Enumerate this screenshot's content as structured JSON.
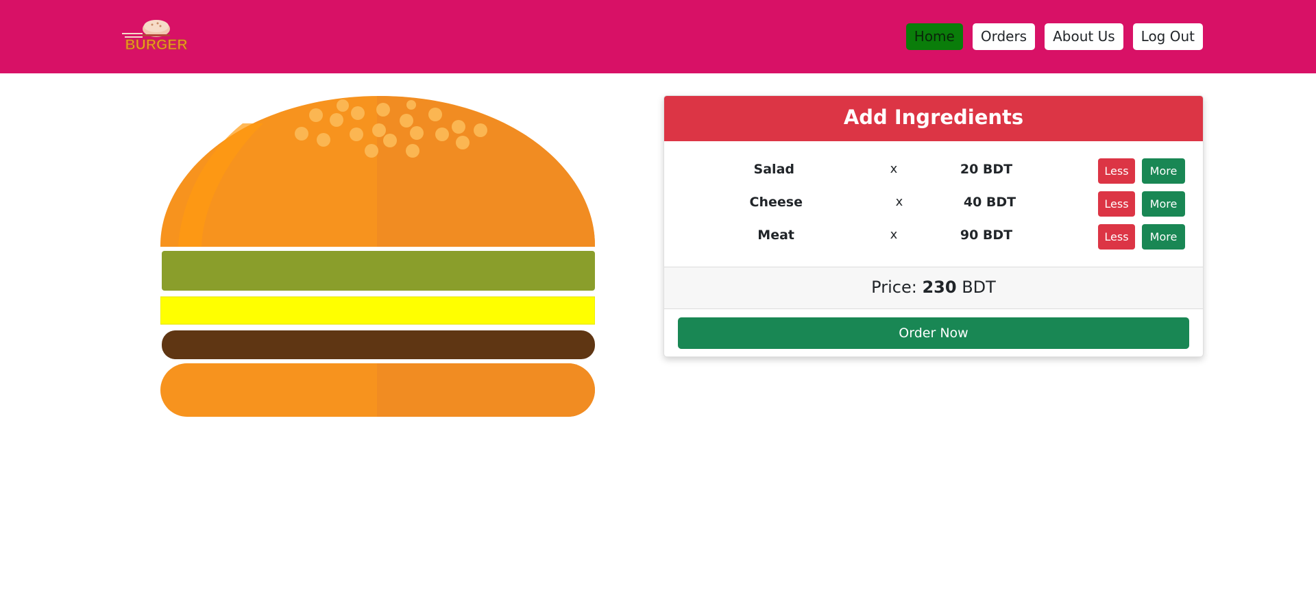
{
  "nav": {
    "logo_text": "BURGER",
    "links": [
      {
        "label": "Home",
        "active": true
      },
      {
        "label": "Orders",
        "active": false
      },
      {
        "label": "About Us",
        "active": false
      },
      {
        "label": "Log Out",
        "active": false
      }
    ]
  },
  "burger": {
    "layers": [
      "salad",
      "cheese",
      "meat"
    ],
    "colors": {
      "bun": "#f7931e",
      "salad": "#8a9e2b",
      "cheese": "#ffff00",
      "meat": "#5f3613"
    }
  },
  "builder": {
    "title": "Add Ingredients",
    "ingredients": [
      {
        "name": "Salad",
        "x": "x",
        "price": "20 BDT",
        "less": "Less",
        "more": "More"
      },
      {
        "name": "Cheese",
        "x": "x",
        "price": "40 BDT",
        "less": "Less",
        "more": "More"
      },
      {
        "name": "Meat",
        "x": "x",
        "price": "90 BDT",
        "less": "Less",
        "more": "More"
      }
    ],
    "price_label": "Price:",
    "price_value": "230",
    "price_unit": "BDT",
    "order_label": "Order Now"
  },
  "colors": {
    "navbar": "#d81166",
    "danger": "#dc3545",
    "success": "#198754",
    "active_nav": "#0a7d0a"
  }
}
